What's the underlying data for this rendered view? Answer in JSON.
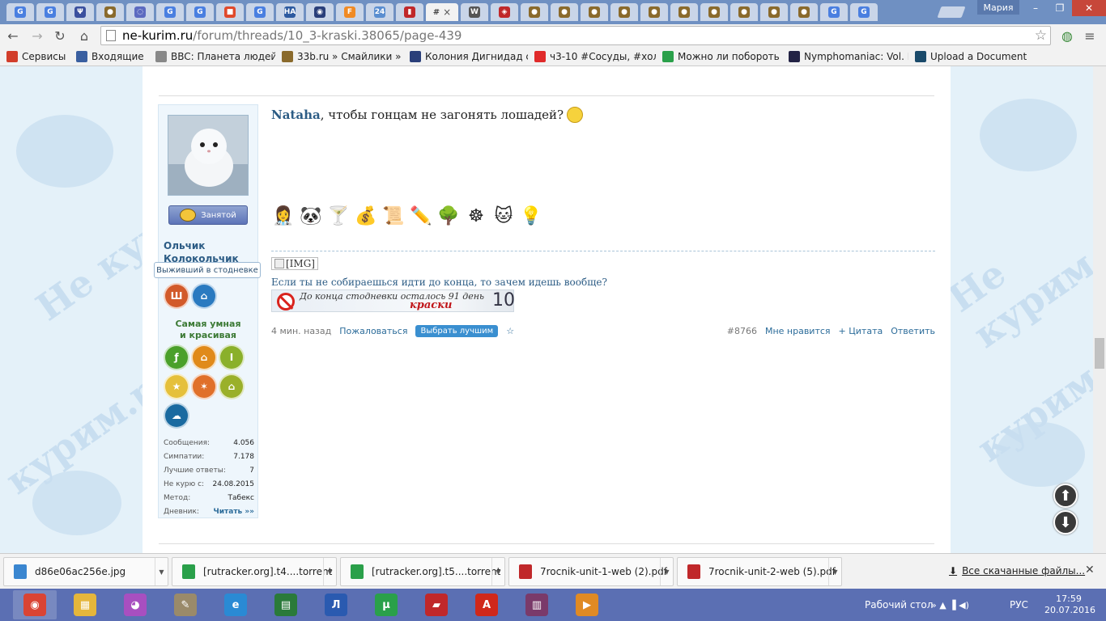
{
  "browser": {
    "profile_name": "Мария",
    "minimize": "–",
    "maximize": "❐",
    "close": "✕",
    "active_tab_letter": "#",
    "tab_close": "×",
    "tabs": [
      {
        "letter": "G",
        "color": "#4a7fe0"
      },
      {
        "letter": "G",
        "color": "#4a7fe0"
      },
      {
        "letter": "Ψ",
        "color": "#3a4f9e"
      },
      {
        "letter": "●",
        "color": "#8a6a2c"
      },
      {
        "letter": "◌",
        "color": "#5c6ac0"
      },
      {
        "letter": "G",
        "color": "#4a7fe0"
      },
      {
        "letter": "G",
        "color": "#4a7fe0"
      },
      {
        "letter": "■",
        "color": "#e0492b"
      },
      {
        "letter": "G",
        "color": "#4a7fe0"
      },
      {
        "letter": "НА",
        "color": "#2d5aa0"
      },
      {
        "letter": "◉",
        "color": "#2a3f7a"
      },
      {
        "letter": "F",
        "color": "#f08a24"
      },
      {
        "letter": "24",
        "color": "#5a8ed0"
      },
      {
        "letter": "▮",
        "color": "#c0282a"
      }
    ],
    "tabs_after": [
      {
        "letter": "W",
        "color": "#555555"
      },
      {
        "letter": "◈",
        "color": "#c0282a"
      },
      {
        "letter": "●",
        "color": "#8a6a2c"
      },
      {
        "letter": "●",
        "color": "#8a6a2c"
      },
      {
        "letter": "●",
        "color": "#8a6a2c"
      },
      {
        "letter": "●",
        "color": "#8a6a2c"
      },
      {
        "letter": "●",
        "color": "#8a6a2c"
      },
      {
        "letter": "●",
        "color": "#8a6a2c"
      },
      {
        "letter": "●",
        "color": "#8a6a2c"
      },
      {
        "letter": "●",
        "color": "#8a6a2c"
      },
      {
        "letter": "●",
        "color": "#8a6a2c"
      },
      {
        "letter": "●",
        "color": "#8a6a2c"
      },
      {
        "letter": "G",
        "color": "#4a7fe0"
      },
      {
        "letter": "G",
        "color": "#4a7fe0"
      }
    ],
    "url_host": "ne-kurim.ru",
    "url_path": "/forum/threads/10_3-kraski.38065/page-439",
    "back": "←",
    "forward": "→",
    "reload": "↻",
    "home": "⌂",
    "star": "☆",
    "menu": "≡",
    "globe": "◍"
  },
  "bookmarks": [
    {
      "label": "Сервисы",
      "color": "#d23d2a"
    },
    {
      "label": "Входящие",
      "color": "#3a5fa0"
    },
    {
      "label": "BBC: Планета людей",
      "color": "#888888"
    },
    {
      "label": "33b.ru » Смайлики »",
      "color": "#8a6a2c"
    },
    {
      "label": "Колония Дигнидад с",
      "color": "#2a3f7a"
    },
    {
      "label": "ч3-10 #Сосуды, #хол",
      "color": "#e02a2a"
    },
    {
      "label": "Можно ли побороть",
      "color": "#2aa04a"
    },
    {
      "label": "Nymphomaniac: Vol. I",
      "color": "#222244"
    },
    {
      "label": "Upload a Document |",
      "color": "#1a4a6a"
    }
  ],
  "user": {
    "busy_label": "Занятой",
    "name": "Ольчик Колокольчик",
    "title": "Выживший в стодневке",
    "slogan": "Самая умная и красивая",
    "stats": [
      {
        "label": "Сообщения:",
        "value": "4.056"
      },
      {
        "label": "Симпатии:",
        "value": "7.178"
      },
      {
        "label": "Лучшие ответы:",
        "value": "7"
      },
      {
        "label": "Не курю с:",
        "value": "24.08.2015"
      },
      {
        "label": "Метод:",
        "value": "Табекс"
      }
    ],
    "diary_label": "Дневник:",
    "diary_link": "Читать »»"
  },
  "post": {
    "mention": "Nataha",
    "text": ", чтобы гонцам не загонять лошадей?",
    "img_alt": "[IMG]",
    "signature": "Если ты не собираешься идти до конца, то зачем идешь вообще?",
    "counter_text": "До конца стодневки осталось 91 день",
    "counter_brand": "краски",
    "counter_number": "10",
    "time": "4 мин. назад",
    "report": "Пожаловаться",
    "best": "Выбрать лучшим",
    "bookmark_star": "☆",
    "post_number": "#8766",
    "like": "Мне нравится",
    "quote": "+ Цитата",
    "reply": "Ответить",
    "smilies": [
      "👩‍⚕️",
      "🐼",
      "🍸",
      "💰",
      "📜",
      "✏️",
      "🌳",
      "☸",
      "🐱",
      "💡"
    ]
  },
  "page_nav": {
    "up": "⬆",
    "down": "⬇"
  },
  "downloads": {
    "items": [
      {
        "name": "d86e06ac256e.jpg",
        "color": "#3a86d0"
      },
      {
        "name": "[rutracker.org].t4....torrent",
        "color": "#2aa04a"
      },
      {
        "name": "[rutracker.org].t5....torrent",
        "color": "#2aa04a"
      },
      {
        "name": "7rocnik-unit-1-web (2).pdf",
        "color": "#c0282a"
      },
      {
        "name": "7rocnik-unit-2-web (5).pdf",
        "color": "#c0282a"
      }
    ],
    "dropdown": "▼",
    "all_label": "Все скачанные файлы...",
    "download_glyph": "⬇",
    "close": "✕"
  },
  "taskbar": {
    "apps": [
      {
        "glyph": "◉",
        "color": "#d94434"
      },
      {
        "glyph": "▦",
        "color": "#e5b63b"
      },
      {
        "glyph": "◕",
        "color": "#a84fc0"
      },
      {
        "glyph": "✎",
        "color": "#9a8a6a"
      },
      {
        "glyph": "e",
        "color": "#2a8ad4"
      },
      {
        "glyph": "▤",
        "color": "#2a7a3a"
      },
      {
        "glyph": "Л",
        "color": "#2a5ab0"
      },
      {
        "glyph": "µ",
        "color": "#2aa04a"
      },
      {
        "glyph": "▰",
        "color": "#c0282a"
      },
      {
        "glyph": "A",
        "color": "#d0281a"
      },
      {
        "glyph": "▥",
        "color": "#7a3a6a"
      },
      {
        "glyph": "▶",
        "color": "#e08a24"
      }
    ],
    "desktop_label": "Рабочий стол",
    "tray_glyphs": "» ▲ ▐ ◀)",
    "language": "РУС",
    "time": "17:59",
    "date": "20.07.2016"
  }
}
